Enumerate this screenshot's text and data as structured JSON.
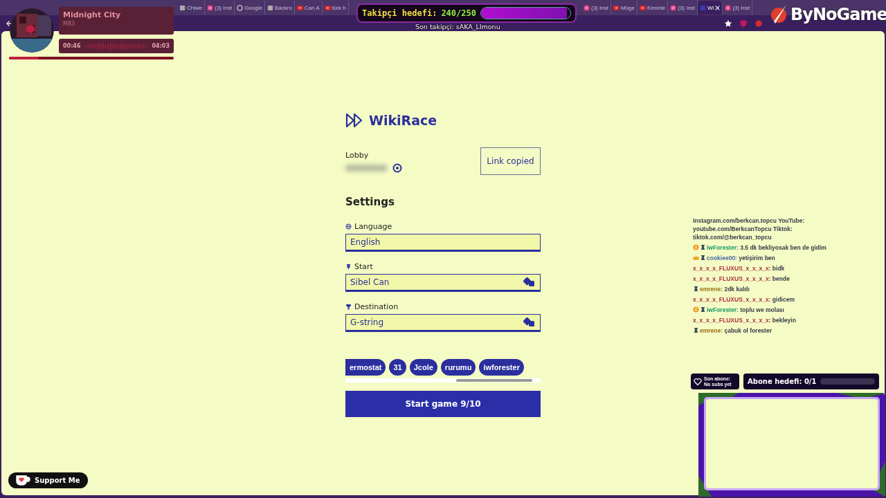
{
  "browser": {
    "tab_groups": [
      {
        "tabs": [
          {
            "title": "Chiwe",
            "kind": "generic",
            "selected": false
          },
          {
            "title": "(3) Inst",
            "kind": "instagram",
            "selected": false
          },
          {
            "title": "Google",
            "kind": "google",
            "selected": false
          },
          {
            "title": "Backro",
            "kind": "generic",
            "selected": false
          },
          {
            "title": "Can A",
            "kind": "youtube",
            "selected": false
          },
          {
            "title": "türk h",
            "kind": "youtube",
            "selected": false
          }
        ]
      },
      {
        "tabs": [
          {
            "title": "(3) Inst",
            "kind": "instagram",
            "selected": false
          },
          {
            "title": "Müge",
            "kind": "youtube",
            "selected": false
          },
          {
            "title": "Kiminle",
            "kind": "youtube",
            "selected": false
          },
          {
            "title": "(3) Inst",
            "kind": "instagram",
            "selected": false
          },
          {
            "title": "Wi",
            "kind": "wiki",
            "selected": true
          },
          {
            "title": "(3) Inst",
            "kind": "instagram",
            "selected": false
          }
        ]
      }
    ]
  },
  "music_player": {
    "title": "Midnight City",
    "artist": "M83",
    "elapsed": "00:46",
    "duration": "04:03",
    "level": 0.18
  },
  "follower_goal": {
    "label": "Takipçi hedefi:",
    "count": "240/250",
    "level": 0.96
  },
  "last_follower": "Son takipçi: sAKA_LImonu",
  "logo": "ByNoGame",
  "app": {
    "title": "WikiRace",
    "lobby_label": "Lobby",
    "copy_button": "Link copied",
    "settings_title": "Settings",
    "fields": [
      {
        "kind": "language",
        "label": "Language",
        "value": "English",
        "random": false
      },
      {
        "kind": "start",
        "label": "Start",
        "value": "Sibel Can",
        "random": true
      },
      {
        "kind": "destination",
        "label": "Destination",
        "value": "G-string",
        "random": true
      }
    ],
    "players": [
      "ermostat",
      "31",
      "Jcole",
      "rurumu",
      "iwforester"
    ],
    "start_button": "Start game 9/10"
  },
  "chat": {
    "messages": [
      {
        "text": "instagram.com/berkcan.topcu YouTube: youtube.com/BerkcanTopcu Tiktok: tiktok.com/@berkcan_topcu"
      },
      {
        "badges": [
          {
            "kind": "coin"
          },
          {
            "kind": "ranger"
          }
        ],
        "user": "iwForester:",
        "color": "#1a9a6a",
        "text": "3.5 dk bekliyosak ben de gidim"
      },
      {
        "badges": [
          {
            "kind": "crown"
          },
          {
            "kind": "ranger"
          }
        ],
        "user": "cookiee00:",
        "color": "#4a6aaa",
        "text": "yetişirim ben"
      },
      {
        "user": "x_x_x_x_FLUXUS_x_x_x_x:",
        "color": "#b03040",
        "text": "bidk"
      },
      {
        "user": "x_x_x_x_FLUXUS_x_x_x_x:",
        "color": "#b03040",
        "text": "bende"
      },
      {
        "badges": [
          {
            "kind": "ranger"
          }
        ],
        "user": "emrene:",
        "color": "#9a7018",
        "text": "2dk kaldı"
      },
      {
        "user": "x_x_x_x_FLUXUS_x_x_x_x:",
        "color": "#b03040",
        "text": "gidicem"
      },
      {
        "badges": [
          {
            "kind": "coin"
          },
          {
            "kind": "ranger"
          }
        ],
        "user": "iwForester:",
        "color": "#1a9a6a",
        "text": "toplu we molası"
      },
      {
        "user": "x_x_x_x_FLUXUS_x_x_x_x:",
        "color": "#b03040",
        "text": "bekleyin"
      },
      {
        "badges": [
          {
            "kind": "ranger"
          }
        ],
        "user": "emrene:",
        "color": "#9a7018",
        "text": "çabuk ol forester"
      }
    ]
  },
  "subs": {
    "last_label": "Son abone:",
    "last_value": "No subs yet",
    "goal": "Abone hedefi: 0/1",
    "level": 0
  },
  "support_button": "Support Me"
}
